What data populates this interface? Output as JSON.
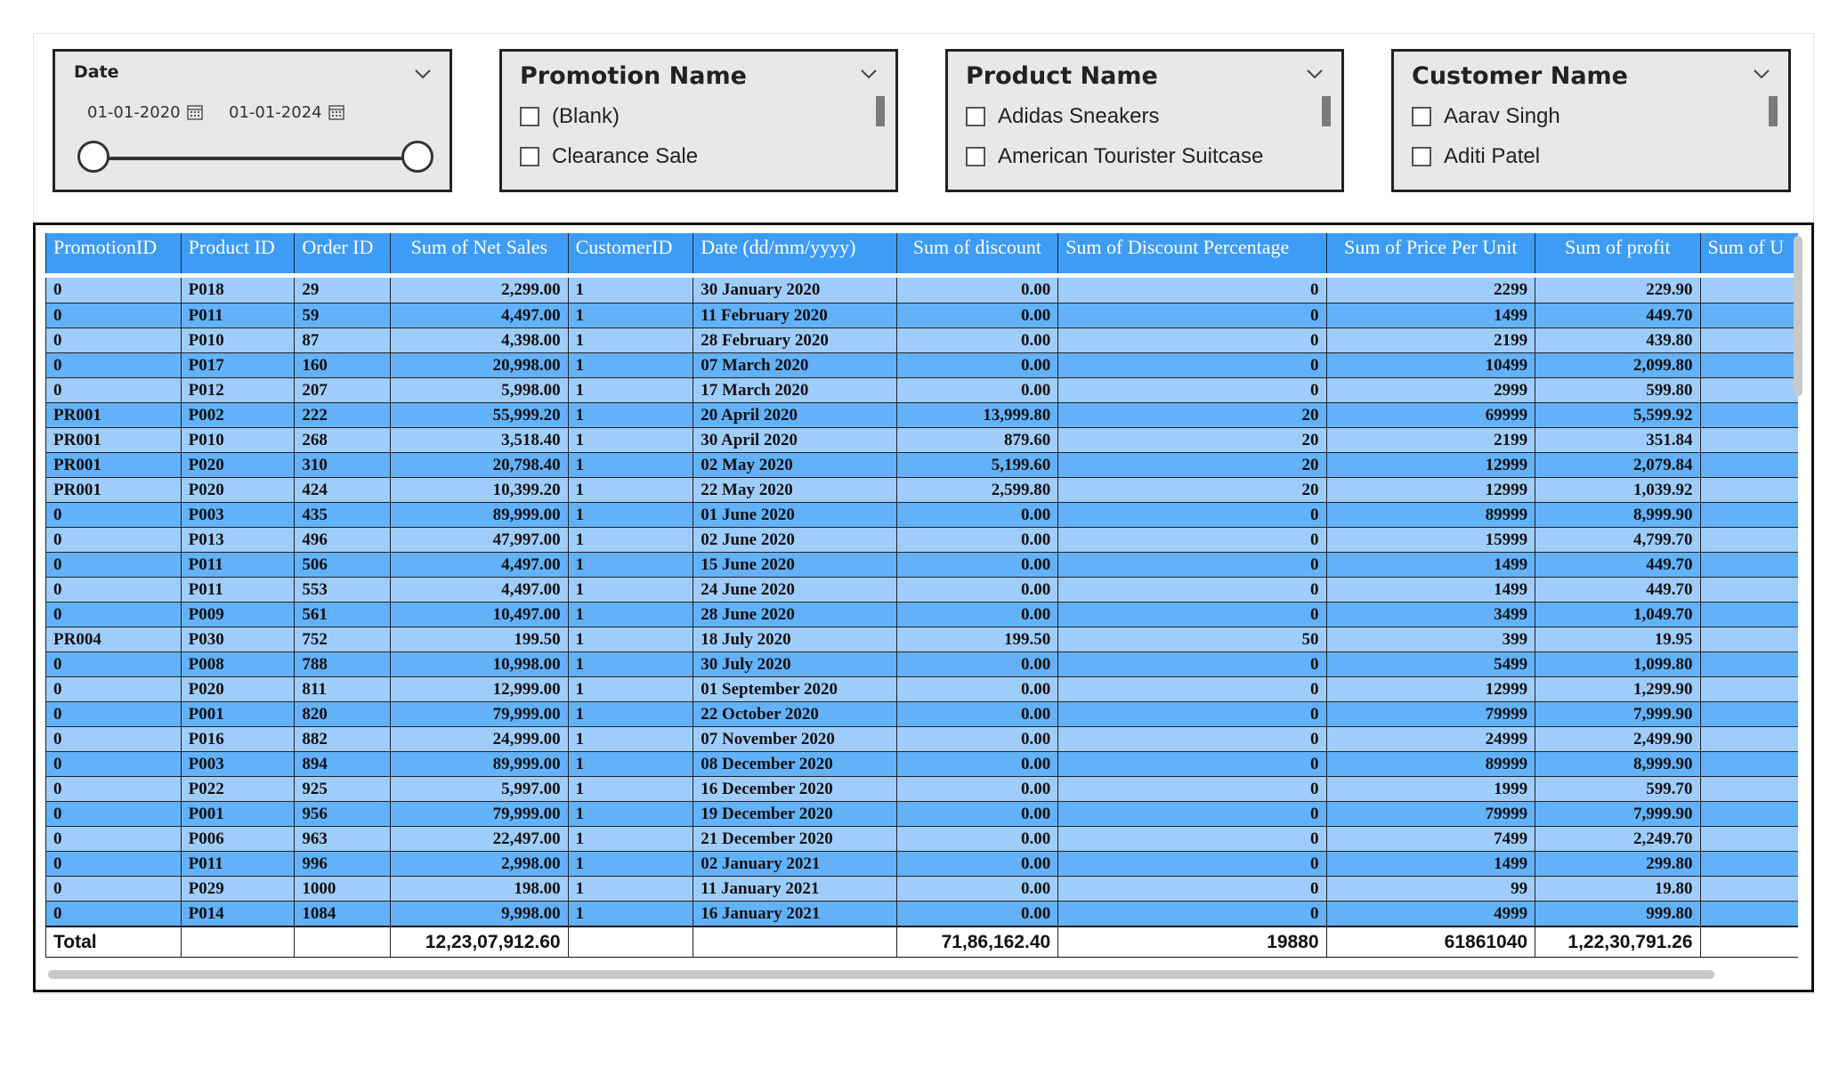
{
  "date_slicer": {
    "title": "Date",
    "start": "01-01-2020",
    "end": "01-01-2024"
  },
  "promotion_slicer": {
    "title": "Promotion Name",
    "items": [
      "(Blank)",
      "Clearance Sale"
    ]
  },
  "product_slicer": {
    "title": "Product Name",
    "items": [
      "Adidas Sneakers",
      "American Tourister Suitcase"
    ]
  },
  "customer_slicer": {
    "title": "Customer Name",
    "items": [
      "Aarav Singh",
      "Aditi Patel"
    ]
  },
  "table": {
    "columns": [
      "PromotionID",
      "Product ID",
      "Order ID",
      "Sum of Net Sales",
      "CustomerID",
      "Date (dd/mm/yyyy)",
      "Sum of discount",
      "Sum of Discount Percentage",
      "Sum of Price Per Unit",
      "Sum of profit",
      "Sum of U"
    ],
    "rows": [
      [
        "0",
        "P018",
        "29",
        "2,299.00",
        "1",
        "30 January 2020",
        "0.00",
        "0",
        "2299",
        "229.90",
        ""
      ],
      [
        "0",
        "P011",
        "59",
        "4,497.00",
        "1",
        "11 February 2020",
        "0.00",
        "0",
        "1499",
        "449.70",
        ""
      ],
      [
        "0",
        "P010",
        "87",
        "4,398.00",
        "1",
        "28 February 2020",
        "0.00",
        "0",
        "2199",
        "439.80",
        ""
      ],
      [
        "0",
        "P017",
        "160",
        "20,998.00",
        "1",
        "07 March 2020",
        "0.00",
        "0",
        "10499",
        "2,099.80",
        ""
      ],
      [
        "0",
        "P012",
        "207",
        "5,998.00",
        "1",
        "17 March 2020",
        "0.00",
        "0",
        "2999",
        "599.80",
        ""
      ],
      [
        "PR001",
        "P002",
        "222",
        "55,999.20",
        "1",
        "20 April 2020",
        "13,999.80",
        "20",
        "69999",
        "5,599.92",
        ""
      ],
      [
        "PR001",
        "P010",
        "268",
        "3,518.40",
        "1",
        "30 April 2020",
        "879.60",
        "20",
        "2199",
        "351.84",
        ""
      ],
      [
        "PR001",
        "P020",
        "310",
        "20,798.40",
        "1",
        "02 May 2020",
        "5,199.60",
        "20",
        "12999",
        "2,079.84",
        ""
      ],
      [
        "PR001",
        "P020",
        "424",
        "10,399.20",
        "1",
        "22 May 2020",
        "2,599.80",
        "20",
        "12999",
        "1,039.92",
        ""
      ],
      [
        "0",
        "P003",
        "435",
        "89,999.00",
        "1",
        "01 June 2020",
        "0.00",
        "0",
        "89999",
        "8,999.90",
        ""
      ],
      [
        "0",
        "P013",
        "496",
        "47,997.00",
        "1",
        "02 June 2020",
        "0.00",
        "0",
        "15999",
        "4,799.70",
        ""
      ],
      [
        "0",
        "P011",
        "506",
        "4,497.00",
        "1",
        "15 June 2020",
        "0.00",
        "0",
        "1499",
        "449.70",
        ""
      ],
      [
        "0",
        "P011",
        "553",
        "4,497.00",
        "1",
        "24 June 2020",
        "0.00",
        "0",
        "1499",
        "449.70",
        ""
      ],
      [
        "0",
        "P009",
        "561",
        "10,497.00",
        "1",
        "28 June 2020",
        "0.00",
        "0",
        "3499",
        "1,049.70",
        ""
      ],
      [
        "PR004",
        "P030",
        "752",
        "199.50",
        "1",
        "18 July 2020",
        "199.50",
        "50",
        "399",
        "19.95",
        ""
      ],
      [
        "0",
        "P008",
        "788",
        "10,998.00",
        "1",
        "30 July 2020",
        "0.00",
        "0",
        "5499",
        "1,099.80",
        ""
      ],
      [
        "0",
        "P020",
        "811",
        "12,999.00",
        "1",
        "01 September 2020",
        "0.00",
        "0",
        "12999",
        "1,299.90",
        ""
      ],
      [
        "0",
        "P001",
        "820",
        "79,999.00",
        "1",
        "22 October 2020",
        "0.00",
        "0",
        "79999",
        "7,999.90",
        ""
      ],
      [
        "0",
        "P016",
        "882",
        "24,999.00",
        "1",
        "07 November 2020",
        "0.00",
        "0",
        "24999",
        "2,499.90",
        ""
      ],
      [
        "0",
        "P003",
        "894",
        "89,999.00",
        "1",
        "08 December 2020",
        "0.00",
        "0",
        "89999",
        "8,999.90",
        ""
      ],
      [
        "0",
        "P022",
        "925",
        "5,997.00",
        "1",
        "16 December 2020",
        "0.00",
        "0",
        "1999",
        "599.70",
        ""
      ],
      [
        "0",
        "P001",
        "956",
        "79,999.00",
        "1",
        "19 December 2020",
        "0.00",
        "0",
        "79999",
        "7,999.90",
        ""
      ],
      [
        "0",
        "P006",
        "963",
        "22,497.00",
        "1",
        "21 December 2020",
        "0.00",
        "0",
        "7499",
        "2,249.70",
        ""
      ],
      [
        "0",
        "P011",
        "996",
        "2,998.00",
        "1",
        "02 January 2021",
        "0.00",
        "0",
        "1499",
        "299.80",
        ""
      ],
      [
        "0",
        "P029",
        "1000",
        "198.00",
        "1",
        "11 January 2021",
        "0.00",
        "0",
        "99",
        "19.80",
        ""
      ],
      [
        "0",
        "P014",
        "1084",
        "9,998.00",
        "1",
        "16 January 2021",
        "0.00",
        "0",
        "4999",
        "999.80",
        ""
      ]
    ],
    "total": [
      "Total",
      "",
      "",
      "12,23,07,912.60",
      "",
      "",
      "71,86,162.40",
      "19880",
      "61861040",
      "1,22,30,791.26",
      ""
    ]
  }
}
